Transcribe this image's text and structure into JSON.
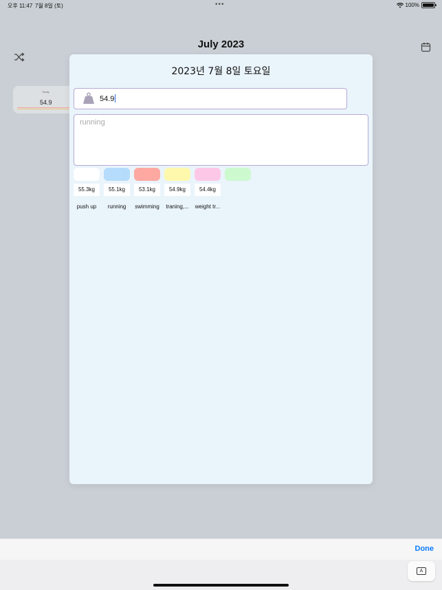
{
  "status_bar": {
    "time": "오후 11:47",
    "date": "7월 8일 (토)",
    "battery": "100%"
  },
  "app": {
    "title": "July 2023",
    "today_card": {
      "label": "Today",
      "value": "54.9",
      "bar_colors": [
        "#f2a9a0",
        "#e8c27a"
      ]
    }
  },
  "modal": {
    "date": "2023년 7월 8일 토요일",
    "weight_icon": "weight-icon",
    "weight_value": "54.9",
    "memo_placeholder": "running",
    "swatches": [
      "#ffffff",
      "#b6dcfb",
      "#fda9a2",
      "#fdf8ac",
      "#fdc8e8",
      "#cdf9cf"
    ],
    "records": [
      {
        "weight": "55.3kg",
        "label": "push up"
      },
      {
        "weight": "55.1kg",
        "label": "running"
      },
      {
        "weight": "53.1kg",
        "label": "swimming"
      },
      {
        "weight": "54.9kg",
        "label": "traning,..."
      },
      {
        "weight": "54.4kg",
        "label": "weight tr..."
      }
    ]
  },
  "keyboard": {
    "done_label": "Done",
    "keyboard_glyph": "A"
  },
  "colors": {
    "accent": "#0a7aff",
    "field_border": "#b7a8d6",
    "modal_bg": "#eaf4fb"
  }
}
